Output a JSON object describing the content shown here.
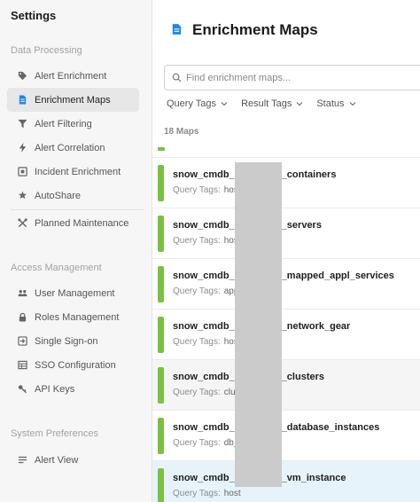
{
  "sidebar": {
    "title": "Settings",
    "sections": [
      {
        "label": "Data Processing",
        "items": [
          {
            "label": "Alert Enrichment",
            "icon": "tag-icon"
          },
          {
            "label": "Enrichment Maps",
            "icon": "document-icon",
            "active": true
          },
          {
            "label": "Alert Filtering",
            "icon": "filter-icon"
          },
          {
            "label": "Alert Correlation",
            "icon": "lightning-icon"
          },
          {
            "label": "Incident Enrichment",
            "icon": "incident-box-icon"
          },
          {
            "label": "AutoShare",
            "icon": "share-icon"
          },
          {
            "label": "Planned Maintenance",
            "icon": "wrench-icon"
          }
        ]
      },
      {
        "label": "Access Management",
        "items": [
          {
            "label": "User Management",
            "icon": "users-icon"
          },
          {
            "label": "Roles Management",
            "icon": "lock-icon"
          },
          {
            "label": "Single Sign-on",
            "icon": "sign-in-icon"
          },
          {
            "label": "SSO Configuration",
            "icon": "table-icon"
          },
          {
            "label": "API Keys",
            "icon": "key-icon"
          }
        ]
      },
      {
        "label": "System Preferences",
        "items": [
          {
            "label": "Alert View",
            "icon": "list-icon"
          }
        ]
      }
    ]
  },
  "main": {
    "title": "Enrichment Maps",
    "search": {
      "placeholder": "Find enrichment maps..."
    },
    "filters": [
      {
        "label": "Query Tags"
      },
      {
        "label": "Result Tags"
      },
      {
        "label": "Status"
      }
    ],
    "count": "18 Maps",
    "maps": [
      {
        "prefix": "snow_cmdb_",
        "suffix": "_containers",
        "tags_label": "Query Tags:",
        "tags_value": "hos"
      },
      {
        "prefix": "snow_cmdb_",
        "suffix": "_servers",
        "tags_label": "Query Tags:",
        "tags_value": "hos"
      },
      {
        "prefix": "snow_cmdb_",
        "suffix": "_mapped_appl_services",
        "tags_label": "Query Tags:",
        "tags_value": "app"
      },
      {
        "prefix": "snow_cmdb_",
        "suffix": "_network_gear",
        "tags_label": "Query Tags:",
        "tags_value": "hos"
      },
      {
        "prefix": "snow_cmdb_",
        "suffix": "_clusters",
        "tags_label": "Query Tags:",
        "tags_value": "clus",
        "state": "hover"
      },
      {
        "prefix": "snow_cmdb_",
        "suffix": "_database_instances",
        "tags_label": "Query Tags:",
        "tags_value": "db_"
      },
      {
        "prefix": "snow_cmdb_",
        "suffix": "_vm_instance",
        "tags_label": "Query Tags:",
        "tags_value": "host",
        "state": "selected"
      }
    ]
  },
  "colors": {
    "accent_green": "#7ac142",
    "title_icon_blue": "#1e88e5",
    "selected_row": "#e6f3fb",
    "sidebar_bg": "#f6f6f6"
  }
}
